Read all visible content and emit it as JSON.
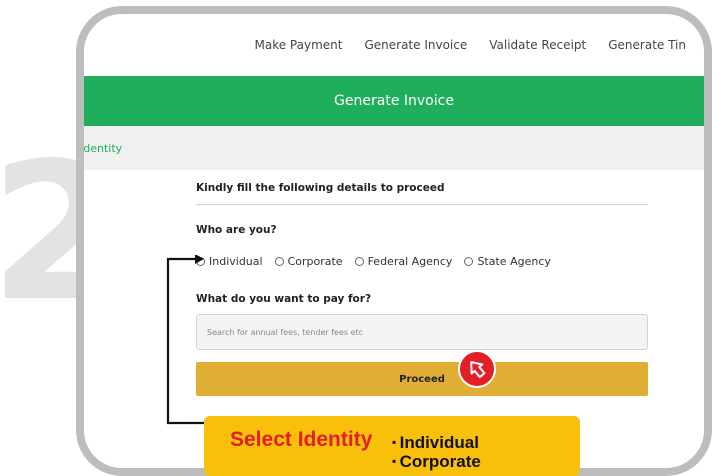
{
  "step": {
    "number": "2"
  },
  "nav": {
    "items": [
      "Make Payment",
      "Generate Invoice",
      "Validate Receipt",
      "Generate Tin"
    ]
  },
  "banner": {
    "title": "Generate Invoice"
  },
  "breadcrumb": {
    "label": "Identity"
  },
  "form": {
    "title": "Kindly fill the following details to proceed",
    "question_identity": "Who are you?",
    "identity_options": [
      "Individual",
      "Corporate",
      "Federal Agency",
      "State Agency"
    ],
    "question_payment": "What do you want to pay for?",
    "search_placeholder": "Search for annual fees, tender fees etc",
    "proceed_label": "Proceed"
  },
  "callout": {
    "title": "Select Identity",
    "items": [
      "Individual",
      "Corporate"
    ]
  },
  "colors": {
    "brand_green": "#1fae5b",
    "proceed_gold": "#e0ae35",
    "callout_yellow": "#f8c00b",
    "accent_red": "#e21f26",
    "frame_gray": "#bdbdbd"
  }
}
